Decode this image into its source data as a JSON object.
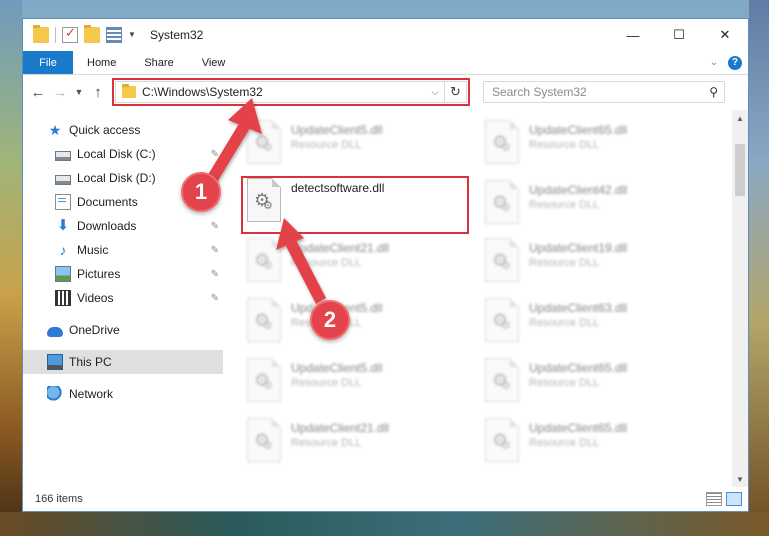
{
  "window": {
    "title": "System32",
    "controls": {
      "minimize": "—",
      "maximize": "☐",
      "close": "✕"
    }
  },
  "ribbon": {
    "file_label": "File",
    "tabs": [
      "Home",
      "Share",
      "View"
    ],
    "help": "?"
  },
  "navbar": {
    "address": "C:\\Windows\\System32",
    "search_placeholder": "Search System32"
  },
  "sidebar": {
    "quick_access": "Quick access",
    "items": [
      {
        "label": "Local Disk (C:)",
        "icon": "drive-icon",
        "pinned": true
      },
      {
        "label": "Local Disk (D:)",
        "icon": "drive-icon",
        "pinned": false
      },
      {
        "label": "Documents",
        "icon": "documents-icon",
        "pinned": true
      },
      {
        "label": "Downloads",
        "icon": "download-icon",
        "pinned": true
      },
      {
        "label": "Music",
        "icon": "music-icon",
        "pinned": true
      },
      {
        "label": "Pictures",
        "icon": "pictures-icon",
        "pinned": true
      },
      {
        "label": "Videos",
        "icon": "videos-icon",
        "pinned": true
      }
    ],
    "onedrive": "OneDrive",
    "this_pc": "This PC",
    "network": "Network"
  },
  "files": {
    "type_label": "Resource DLL",
    "highlighted": {
      "name": "detectsoftware.dll"
    },
    "left_column": [
      "UpdateClient5.dll",
      "",
      "UpdateClient21.dll",
      "UpdateClient5.dll",
      "UpdateClient5.dll",
      "UpdateClient21.dll"
    ],
    "right_column": [
      "UpdateClient65.dll",
      "UpdateClient42.dll",
      "UpdateClient19.dll",
      "UpdateClient63.dll",
      "UpdateClient65.dll",
      "UpdateClient65.dll"
    ]
  },
  "status": {
    "item_count": "166 items"
  },
  "annotations": {
    "step1": "1",
    "step2": "2",
    "color": "#e3434a"
  }
}
